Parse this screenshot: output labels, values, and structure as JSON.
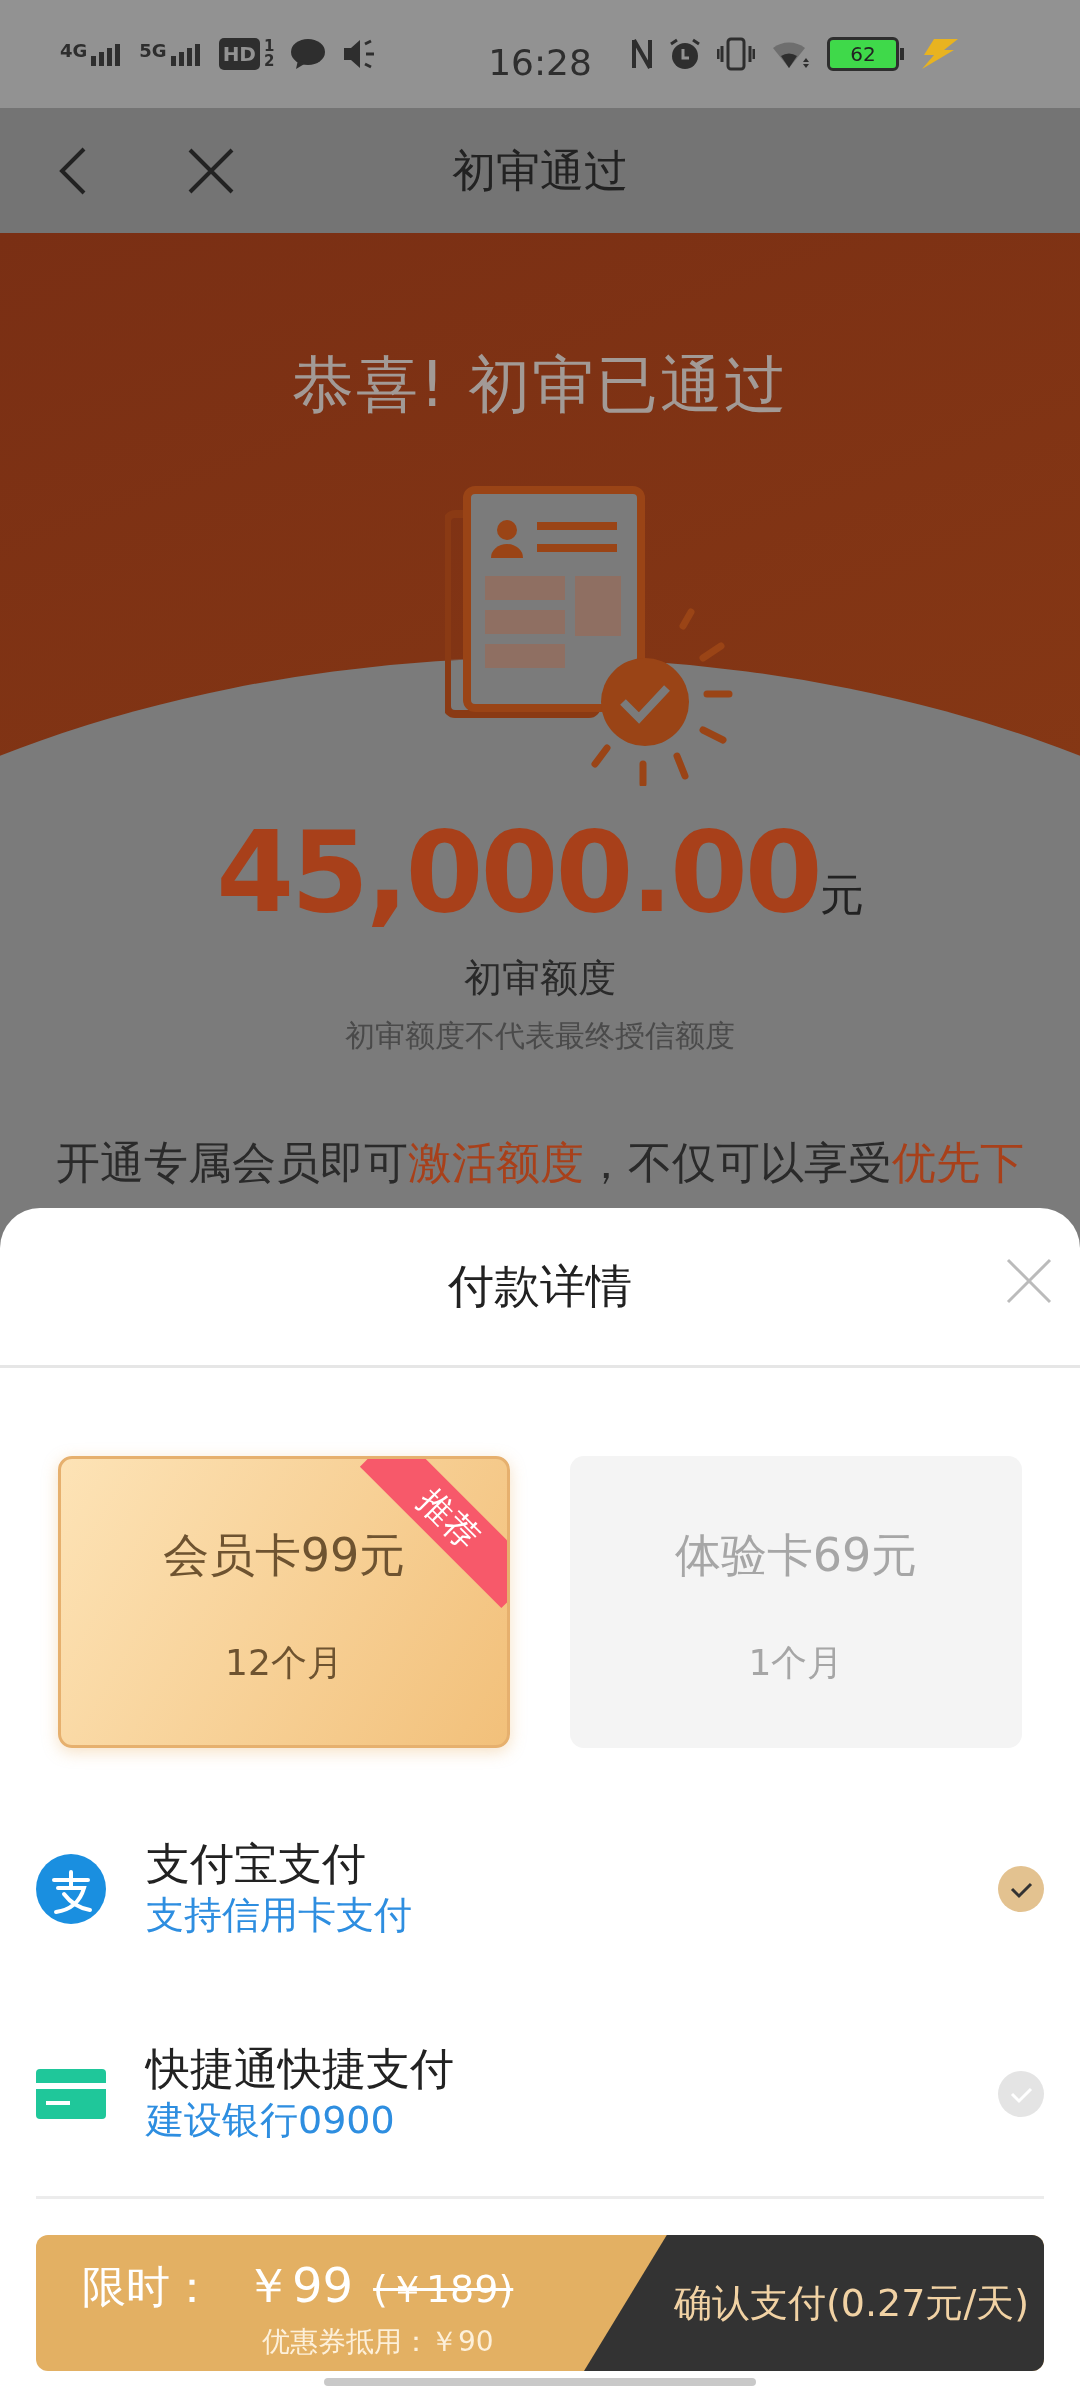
{
  "status_bar": {
    "signals": [
      {
        "label": "4G"
      },
      {
        "label": "5G"
      }
    ],
    "hd_label": "HD",
    "hd_sims": [
      "1",
      "2"
    ],
    "time": "16:28",
    "battery": "62"
  },
  "nav": {
    "title": "初审通过"
  },
  "hero": {
    "headline": "恭喜! 初审已通过",
    "amount": "45,000.00",
    "unit": "元",
    "amount_label": "初审额度",
    "note": "初审额度不代表最终授信额度",
    "promo": [
      {
        "text": "开通专属会员即可",
        "highlight": false
      },
      {
        "text": "激活额度",
        "highlight": true
      },
      {
        "text": "，不仅可以享受",
        "highlight": false
      },
      {
        "text": "优先下",
        "highlight": true
      }
    ]
  },
  "sheet": {
    "title": "付款详情",
    "plans": [
      {
        "name": "会员卡99元",
        "duration": "12个月",
        "selected": true,
        "ribbon": "推荐"
      },
      {
        "name": "体验卡69元",
        "duration": "1个月",
        "selected": false
      }
    ],
    "payment_methods": [
      {
        "kind": "alipay",
        "title": "支付宝支付",
        "subtitle": "支持信用卡支付",
        "selected": true
      },
      {
        "kind": "card",
        "title": "快捷通快捷支付",
        "subtitle": "建设银行0900",
        "selected": false
      }
    ],
    "checkout": {
      "label": "限时：",
      "price": "￥99",
      "original_price": "(￥189)",
      "coupon": "优惠券抵用：￥90",
      "button": "确认支付(0.27元/天)"
    }
  }
}
